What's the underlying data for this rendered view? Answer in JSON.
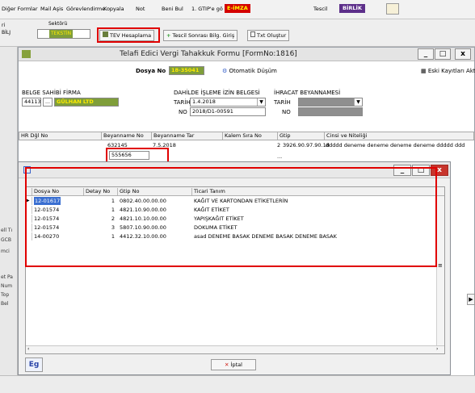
{
  "toolbar": {
    "items": [
      "Diğer Formlar",
      "Mail Aşis",
      "Görevlendirme",
      "Kopyala",
      "Not",
      "Beni Bul",
      "1. GTIP'e gö"
    ],
    "eimza": "E-İMZA",
    "tescil": "Tescil",
    "birlik": "BİRLİK"
  },
  "strip": {
    "sektor_label": "Sektörü",
    "sektor_value": "TEKSTİN",
    "left_frag1": "ri",
    "left_frag2": "BİLJ",
    "tev_button": "TEV Hesaplama",
    "tescil_sonrasi": "Tescil Sonrası Bilg. Giriş",
    "txt_olustur": "Txt Oluştur"
  },
  "left_panel": {
    "frags": [
      "ell Tı",
      "GCB",
      "mci",
      "et Pa",
      "Num",
      "Top",
      "Bel"
    ]
  },
  "form": {
    "title": "Telafi Edici Vergi Tahakkuk Formu [FormNo:1816]",
    "dosya_label": "Dosya No",
    "dosya_value": "18-35041",
    "otomatik_button": "Otomatik Düşüm",
    "eski_button": "Eski Kayıtları Aktar",
    "belge_sahibi_label": "BELGE SAHİBİ FİRMA",
    "firma_kod": "44113",
    "firma_name": "GÜLHAN LTD",
    "dahilde_label": "DAHİLDE İŞLEME İZİN BELGESİ",
    "dahilde_tarih_label": "TARİH",
    "dahilde_tarih": "1.4.2018",
    "dahilde_no_label": "NO",
    "dahilde_no": "2018/D1-00591",
    "ihracat_label": "İHRACAT BEYANNAMESİ",
    "ihracat_tarih_label": "TARİH",
    "ihracat_no_label": "NO",
    "grid_cols": [
      "HR Dğl No",
      "Beyanname No",
      "Beyanname Tar",
      "Kalem Sıra No",
      "Gtip",
      "Cinsi ve Niteliği"
    ],
    "grid_row1": {
      "beyan_no": "632145",
      "tarih": "7.5.2018",
      "kalem": "2",
      "gtip": "3926.90.97.90.18",
      "cins": "ddddd deneme deneme deneme deneme ddddd ddd"
    },
    "grid_row2": {
      "beyan_no": "555656",
      "cins": "..."
    }
  },
  "popup": {
    "columns": [
      "Dosya No",
      "Detay No",
      "Gtip No",
      "Ticari Tanım"
    ],
    "rows": [
      {
        "dosya": "12-01617",
        "detay": "1",
        "gtip": "0802.40.00.00.00",
        "tanim": "KAĞIT VE KARTONDAN ETİKETLERİN"
      },
      {
        "dosya": "12-01574",
        "detay": "1",
        "gtip": "4821.10.90.00.00",
        "tanim": "KAĞIT ETİKET"
      },
      {
        "dosya": "12-01574",
        "detay": "2",
        "gtip": "4821.10.10.00.00",
        "tanim": "YAPIŞKAĞIT ETİKET"
      },
      {
        "dosya": "12-01574",
        "detay": "3",
        "gtip": "5807.10.90.00.00",
        "tanim": "DOKUMA ETİKET"
      },
      {
        "dosya": "14-00270",
        "detay": "1",
        "gtip": "4412.32.10.00.00",
        "tanim": "asad DENEME BASAK DENEME BASAK DENEME BASAK"
      }
    ],
    "cancel_label": "İptal",
    "logo_text": "Eg"
  }
}
